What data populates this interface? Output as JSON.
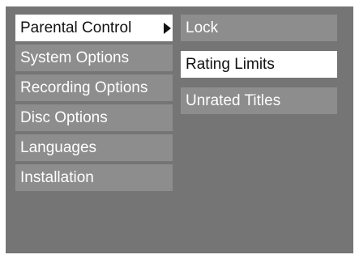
{
  "main_menu": {
    "items": [
      {
        "label": "Parental Control"
      },
      {
        "label": "System Options"
      },
      {
        "label": "Recording Options"
      },
      {
        "label": "Disc Options"
      },
      {
        "label": "Languages"
      },
      {
        "label": "Installation"
      }
    ],
    "selected_index": 0
  },
  "sub_menu": {
    "items": [
      {
        "label": "Lock"
      },
      {
        "label": "Rating Limits"
      },
      {
        "label": "Unrated Titles"
      }
    ],
    "highlighted_index": 1
  },
  "icons": {
    "submenu_arrow": "triangle-right-icon"
  },
  "colors": {
    "screen_background": "#757575",
    "item_background": "#8d8d8d",
    "selected_background": "#ffffff",
    "selected_text": "#111111",
    "item_text": "#ffffff"
  }
}
